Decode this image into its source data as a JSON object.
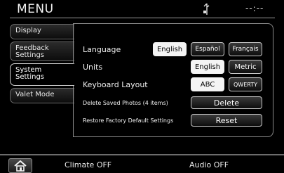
{
  "header": {
    "title": "MENU",
    "clock": "--:--",
    "status_icon": "phone-signal-icon"
  },
  "tabs": [
    {
      "label": "Display",
      "active": false
    },
    {
      "label": "Feedback Settings",
      "active": false
    },
    {
      "label": "System Settings",
      "active": true
    },
    {
      "label": "Valet Mode",
      "active": false
    }
  ],
  "settings": {
    "language": {
      "label": "Language",
      "options": [
        "English",
        "Español",
        "Français"
      ],
      "selected": "English"
    },
    "units": {
      "label": "Units",
      "options": [
        "English",
        "Metric"
      ],
      "selected": "English"
    },
    "keyboard": {
      "label": "Keyboard Layout",
      "options": [
        "ABC",
        "QWERTY"
      ],
      "selected": "ABC"
    },
    "delete_photos": {
      "label": "Delete Saved Photos (4 items)",
      "button": "Delete"
    },
    "reset": {
      "label": "Restore Factory Default Settings",
      "button": "Reset"
    }
  },
  "footer": {
    "home_icon": "home-icon",
    "climate": "Climate OFF",
    "audio": "Audio OFF"
  },
  "colors": {
    "background": "#000000",
    "selected_button": "#f4f4f4",
    "border": "#c8c8c8"
  }
}
